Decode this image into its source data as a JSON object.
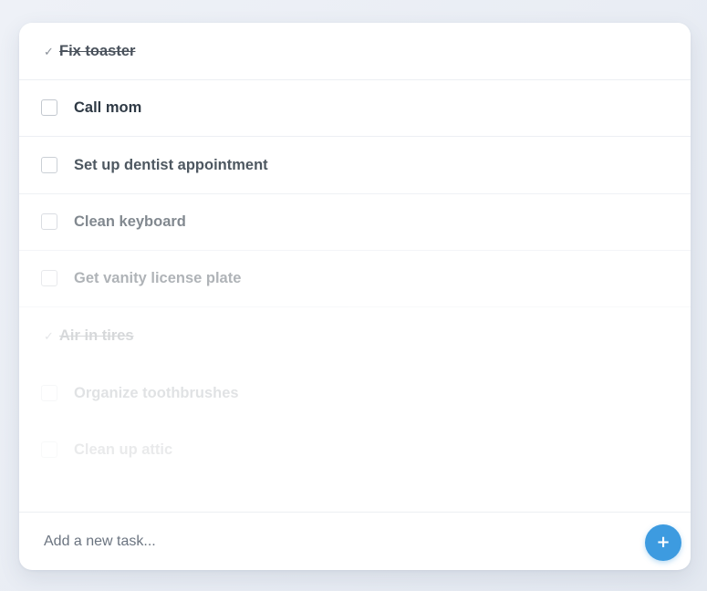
{
  "tasks": [
    {
      "label": "Fix toaster",
      "done": true,
      "check": "✓"
    },
    {
      "label": "Call mom",
      "done": false
    },
    {
      "label": "Set up dentist appointment",
      "done": false
    },
    {
      "label": "Clean keyboard",
      "done": false
    },
    {
      "label": "Get vanity license plate",
      "done": false
    },
    {
      "label": "Air in tires",
      "done": true,
      "check": "✓"
    },
    {
      "label": "Organize toothbrushes",
      "done": false
    },
    {
      "label": "Clean up attic",
      "done": false
    }
  ],
  "new_task": {
    "placeholder": "Add a new task...",
    "add_label": "+"
  },
  "colors": {
    "accent": "#3d9be0",
    "text": "#2f3a45",
    "checkbox_border": "#c3c8cf"
  },
  "icons": {
    "done": "checkmark-icon",
    "add": "plus-icon"
  }
}
